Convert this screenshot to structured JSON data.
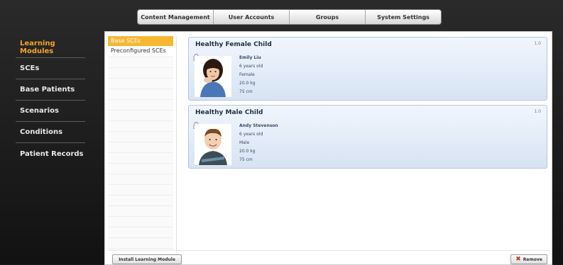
{
  "top_tabs": [
    "Content Management",
    "User Accounts",
    "Groups",
    "System Settings"
  ],
  "nav": {
    "items": [
      "Learning Modules",
      "SCEs",
      "Base Patients",
      "Scenarios",
      "Conditions",
      "Patient Records"
    ],
    "active": "Learning Modules"
  },
  "subnav": {
    "items": [
      "Base SCEs",
      "Preconfigured SCEs"
    ],
    "active": "Base SCEs"
  },
  "cards": [
    {
      "title": "Healthy Female Child",
      "version": "1.0",
      "name": "Emily Liu",
      "age": "6 years old",
      "gender": "Female",
      "weight": "20.0 kg",
      "height": "75 cm"
    },
    {
      "title": "Healthy Male Child",
      "version": "1.0",
      "name": "Andy Stevenson",
      "age": "6 years old",
      "gender": "Male",
      "weight": "20.0 kg",
      "height": "75 cm"
    }
  ],
  "buttons": {
    "install": "Install Learning Module",
    "remove": "Remove"
  },
  "colors": {
    "accent": "#f5a623",
    "card_top": "#f1f6fd",
    "card_bottom": "#d7e3f3",
    "remove_icon": "#c0392b"
  },
  "icons": {
    "lock": "lock-icon",
    "remove": "close-x-icon"
  }
}
